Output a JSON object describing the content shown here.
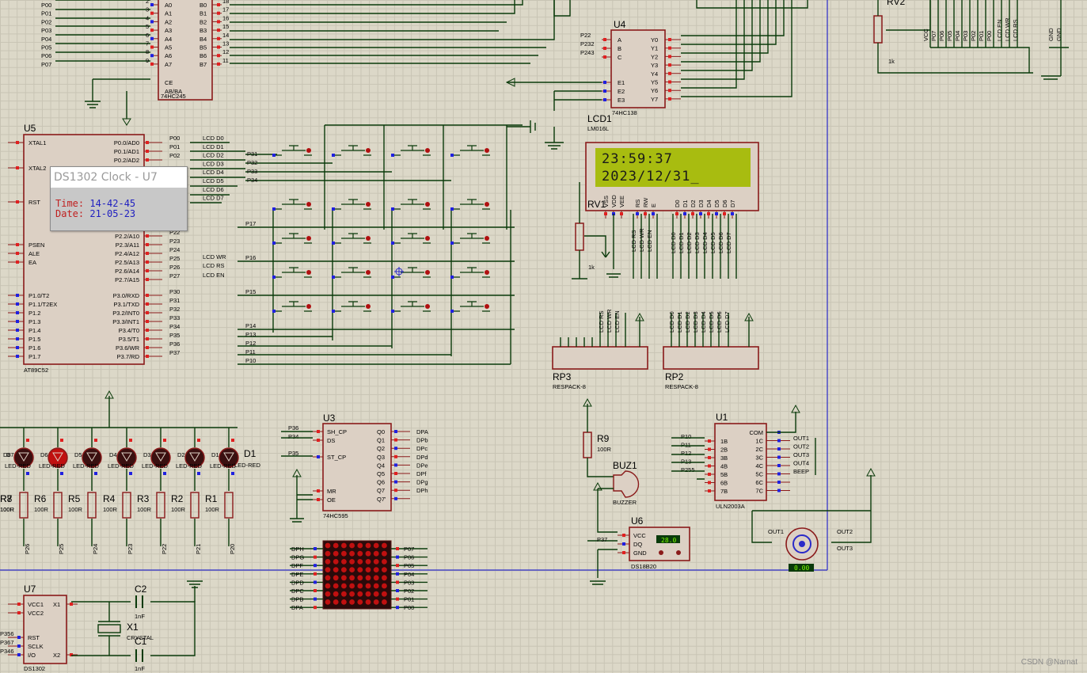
{
  "popup": {
    "title": "DS1302 Clock - U7",
    "time_label": "Time:",
    "time_value": "14-42-45",
    "date_label": "Date:",
    "date_value": "21-05-23"
  },
  "lcd": {
    "line1": "23:59:37",
    "line2": "2023/12/31_"
  },
  "components": {
    "u5": {
      "ref": "U5",
      "name": "AT89C52"
    },
    "u74245": {
      "name": "74HC245"
    },
    "u4": {
      "ref": "U4",
      "name": "74HC138"
    },
    "lcd1": {
      "ref": "LCD1",
      "name": "LM016L"
    },
    "rv1": {
      "ref": "RV1",
      "value": "1k"
    },
    "rv2": {
      "ref": "RV2",
      "value": "1k"
    },
    "u3": {
      "ref": "U3",
      "name": "74HC595"
    },
    "u1": {
      "ref": "U1",
      "name": "ULN2003A"
    },
    "u6": {
      "ref": "U6",
      "name": "DS18B20",
      "reading": "28.0"
    },
    "u7": {
      "ref": "U7",
      "name": "DS1302"
    },
    "rp3": {
      "ref": "RP3",
      "name": "RESPACK-8"
    },
    "rp2": {
      "ref": "RP2",
      "name": "RESPACK-8"
    },
    "r9": {
      "ref": "R9",
      "value": "100R"
    },
    "buz1": {
      "ref": "BUZ1",
      "name": "BUZZER"
    },
    "c2": {
      "ref": "C2",
      "value": "1nF"
    },
    "c1": {
      "ref": "C1",
      "value": "1nF"
    },
    "x1": {
      "ref": "X1",
      "name": "CRYSTAL"
    },
    "motor": {
      "reading": "0.00"
    }
  },
  "u5_left_pins": [
    "XTAL1",
    "XTAL2",
    "RST",
    "PSEN",
    "ALE",
    "EA",
    "P1.0/T2",
    "P1.1/T2EX",
    "P1.2",
    "P1.3",
    "P1.4",
    "P1.5",
    "P1.6",
    "P1.7"
  ],
  "u5_right_pins": [
    "P0.0/AD0",
    "P0.1/AD1",
    "P0.2/AD2",
    "P2.2/A10",
    "P2.3/A11",
    "P2.4/A12",
    "P2.5/A13",
    "P2.6/A14",
    "P2.7/A15",
    "P3.0/RXD",
    "P3.1/TXD",
    "P3.2/INT0",
    "P3.3/INT1",
    "P3.4/T0",
    "P3.5/T1",
    "P3.6/WR",
    "P3.7/RD"
  ],
  "p0_nets": [
    "P00",
    "P01",
    "P02",
    "P03",
    "P04",
    "P05",
    "P06",
    "P07"
  ],
  "lcd_nets": [
    "LCD D0",
    "LCD D1",
    "LCD D2",
    "LCD D3",
    "LCD D4",
    "LCD D5",
    "LCD D6",
    "LCD D7"
  ],
  "p2_nets": [
    "P22",
    "P23",
    "P24",
    "P25",
    "P26",
    "P27"
  ],
  "p3_nets": [
    "P30",
    "P31",
    "P32",
    "P33",
    "P34",
    "P35",
    "P36",
    "P37"
  ],
  "wr_nets": [
    "LCD WR",
    "LCD RS",
    "LCD EN"
  ],
  "ah_labels": [
    "A0",
    "A1",
    "A2",
    "A3",
    "A4",
    "A5",
    "A6",
    "A7"
  ],
  "bh_labels": [
    "B0",
    "B1",
    "B2",
    "B3",
    "B4",
    "B5",
    "B6",
    "B7"
  ],
  "u4_outs": [
    "Y0",
    "Y1",
    "Y2",
    "Y3",
    "Y4",
    "Y5",
    "Y6",
    "Y7"
  ],
  "u4_ins": [
    "A",
    "B",
    "C",
    "E1",
    "E2",
    "E3"
  ],
  "u4_nets": [
    "P22",
    "P232",
    "P243"
  ],
  "key_row_labels": [
    "P31",
    "P32",
    "P33",
    "P34"
  ],
  "matrix_labels": [
    "P17",
    "P16",
    "P15",
    "P14",
    "P13",
    "P12",
    "P11",
    "P10"
  ],
  "leds": [
    "D8",
    "D7",
    "D6",
    "D5",
    "D4",
    "D3",
    "D2",
    "D1"
  ],
  "led_type": "LED-RED",
  "resistors": [
    "R8",
    "R7",
    "R6",
    "R5",
    "R4",
    "R3",
    "R2",
    "R1"
  ],
  "resistor_value": "100R",
  "resistor_nets": [
    "P26",
    "P25",
    "P24",
    "P23",
    "P22",
    "P21",
    "P20"
  ],
  "u3_left": [
    "SH_CP",
    "DS",
    "ST_CP",
    "MR",
    "OE"
  ],
  "u3_left_nets": [
    "P36",
    "P34",
    "P35"
  ],
  "u3_right": [
    "Q0",
    "Q1",
    "Q2",
    "Q3",
    "Q4",
    "Q5",
    "Q6",
    "Q7",
    "Q7'"
  ],
  "u3_right_nets": [
    "DPA",
    "DPb",
    "DPc",
    "DPd",
    "DPe",
    "DPf",
    "DPg",
    "DPh"
  ],
  "matrix_left": [
    "DPH",
    "DPG",
    "DPF",
    "DPE",
    "DPD",
    "DPC",
    "DPB",
    "DPA"
  ],
  "matrix_right": [
    "P07",
    "P06",
    "P05",
    "P04",
    "P03",
    "P02",
    "P01",
    "P00"
  ],
  "u1_left": [
    "1B",
    "2B",
    "3B",
    "4B",
    "5B",
    "6B",
    "7B"
  ],
  "u1_left_nets": [
    "P10",
    "P11",
    "P12",
    "P13",
    "P255"
  ],
  "u1_right": [
    "COM",
    "1C",
    "2C",
    "3C",
    "4C",
    "5C",
    "6C",
    "7C"
  ],
  "u1_right_nets": [
    "OUT1",
    "OUT2",
    "OUT3",
    "OUT4",
    "BEEP"
  ],
  "lcd_pins": [
    "VSS",
    "VDD",
    "VEE",
    "RS",
    "RW",
    "E",
    "D0",
    "D1",
    "D2",
    "D3",
    "D4",
    "D5",
    "D6",
    "D7"
  ],
  "rp3_nets": [
    "LCD RS",
    "LCD WR",
    "LCD EN"
  ],
  "rp2_nets": [
    "LCD D0",
    "LCD D1",
    "LCD D2",
    "LCD D3",
    "LCD D4",
    "LCD D5",
    "LCD D6",
    "LCD D7"
  ],
  "rv2_nets": [
    "VCC",
    "P07",
    "P06",
    "P05",
    "P04",
    "P03",
    "P02",
    "P01",
    "P00",
    "LCD EN",
    "LCD WR",
    "LCD RS",
    "GND",
    "GND"
  ],
  "u6_pins": [
    "VCC",
    "DQ",
    "GND"
  ],
  "u6_net": "P37",
  "u7_left": [
    "VCC1",
    "VCC2",
    "RST",
    "SCLK",
    "I/O"
  ],
  "u7_left_nets": [
    "P356",
    "P367",
    "P346"
  ],
  "u7_right": [
    "X1",
    "X2"
  ],
  "u74245_ctrl": [
    "CE",
    "AB/BA"
  ],
  "motor_labels": [
    "OUT1",
    "OUT2",
    "OUT3"
  ],
  "watermark": "CSDN @Narnat"
}
